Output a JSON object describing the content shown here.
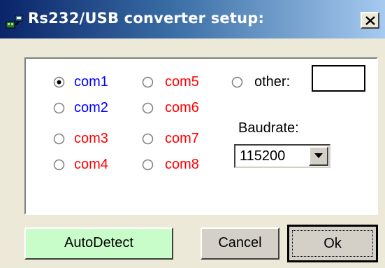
{
  "window": {
    "title": "Rs232/USB converter setup:",
    "close_label": "×"
  },
  "ports": {
    "selected": "com1",
    "items": [
      {
        "label": "com1",
        "color": "#0000ff",
        "checked": true
      },
      {
        "label": "com2",
        "color": "#0000ff",
        "checked": false
      },
      {
        "label": "com3",
        "color": "#ff0000",
        "checked": false
      },
      {
        "label": "com4",
        "color": "#ff0000",
        "checked": false
      },
      {
        "label": "com5",
        "color": "#ff0000",
        "checked": false
      },
      {
        "label": "com6",
        "color": "#ff0000",
        "checked": false
      },
      {
        "label": "com7",
        "color": "#ff0000",
        "checked": false
      },
      {
        "label": "com8",
        "color": "#ff0000",
        "checked": false
      }
    ],
    "other_label": "other:",
    "other_value": ""
  },
  "baud": {
    "label": "Baudrate:",
    "value": "115200"
  },
  "buttons": {
    "autodetect": "AutoDetect",
    "cancel": "Cancel",
    "ok": "Ok"
  },
  "colors": {
    "autodetect_bg": "#c8fcc8",
    "title_gradient_start": "#0a246a",
    "title_gradient_end": "#a6caf0"
  },
  "icons": {
    "title": "usb-cable-icon",
    "close": "close-icon",
    "dropdown": "chevron-down-icon"
  }
}
